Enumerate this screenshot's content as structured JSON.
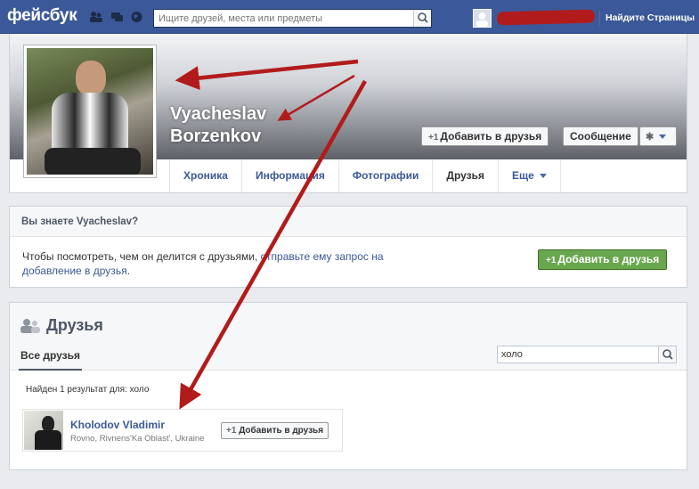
{
  "topbar": {
    "logo": "фейсбук",
    "search_placeholder": "Ищите друзей, места или предметы",
    "find_pages": "Найдите Страницы"
  },
  "profile": {
    "first_name": "Vyacheslav",
    "last_name": "Borzenkov",
    "add_friend": "Добавить в друзья",
    "message": "Сообщение",
    "tabs": [
      "Хроника",
      "Информация",
      "Фотографии",
      "Друзья",
      "Еще"
    ]
  },
  "know": {
    "heading": "Вы знаете Vyacheslav?",
    "text": "Чтобы посмотреть, чем он делится с друзьями,",
    "link": "отправьте ему запрос на добавление в друзья",
    "end": ".",
    "button": "Добавить в друзья"
  },
  "friends": {
    "title": "Друзья",
    "all_tab": "Все друзья",
    "search_value": "холо",
    "results": "Найден 1 результат для: холо",
    "card": {
      "name": "Kholodov Vladimir",
      "location": "Rovno, Rivnens'Ka Oblast', Ukraine",
      "button": "Добавить в друзья"
    }
  },
  "colors": {
    "brand": "#3b5998",
    "green_button": "#69a74e",
    "annotation_red": "#b21b1b"
  }
}
